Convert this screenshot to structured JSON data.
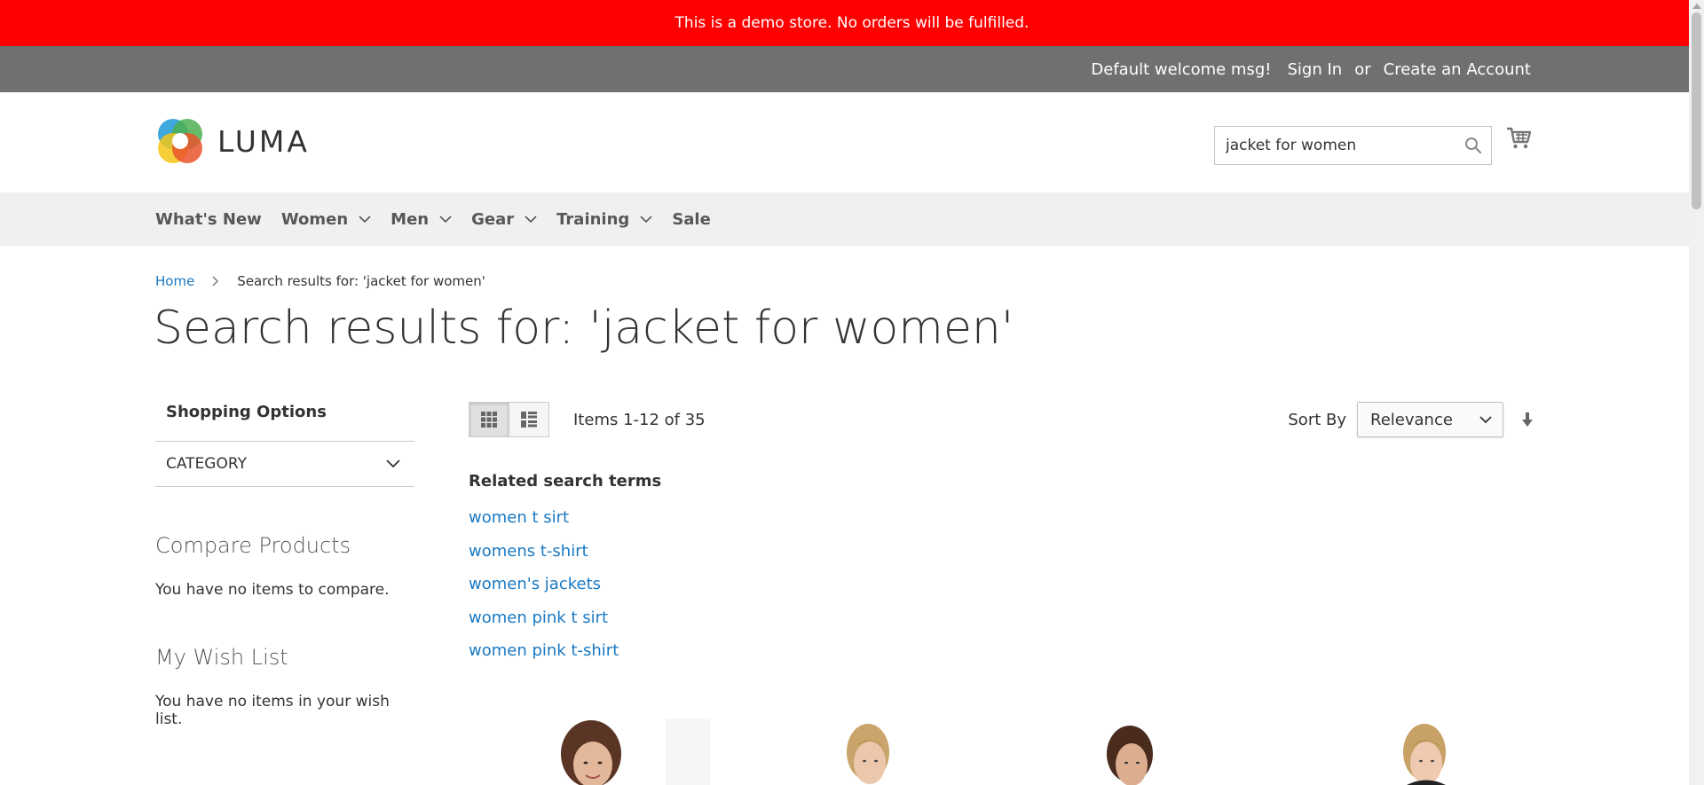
{
  "demo_notice": "This is a demo store. No orders will be fulfilled.",
  "panel": {
    "welcome": "Default welcome msg!",
    "sign_in": "Sign In",
    "or": "or",
    "create_account": "Create an Account"
  },
  "logo": {
    "text": "LUMA"
  },
  "search": {
    "value": "jacket for women"
  },
  "nav": {
    "items": [
      {
        "label": "What's New",
        "has_dropdown": false
      },
      {
        "label": "Women",
        "has_dropdown": true
      },
      {
        "label": "Men",
        "has_dropdown": true
      },
      {
        "label": "Gear",
        "has_dropdown": true
      },
      {
        "label": "Training",
        "has_dropdown": true
      },
      {
        "label": "Sale",
        "has_dropdown": false
      }
    ]
  },
  "breadcrumbs": {
    "home": "Home",
    "current": "Search results for: 'jacket for women'"
  },
  "page_title": "Search results for: 'jacket for women'",
  "sidebar": {
    "shopping_options": "Shopping Options",
    "category": "Category",
    "compare_title": "Compare Products",
    "compare_empty": "You have no items to compare.",
    "wishlist_title": "My Wish List",
    "wishlist_empty": "You have no items in your wish list."
  },
  "toolbar": {
    "amount": "Items 1-12 of 35",
    "sort_label": "Sort By",
    "sort_value": "Relevance"
  },
  "related": {
    "title": "Related search terms",
    "terms": [
      "women t sirt",
      "womens t-shirt",
      "women's jackets",
      "women pink t sirt",
      "women pink t-shirt"
    ]
  },
  "colors": {
    "demo_bar": "#ff0000",
    "panel_header": "#6e716e",
    "nav_bg": "#f0f0f0",
    "link": "#1979c3"
  }
}
